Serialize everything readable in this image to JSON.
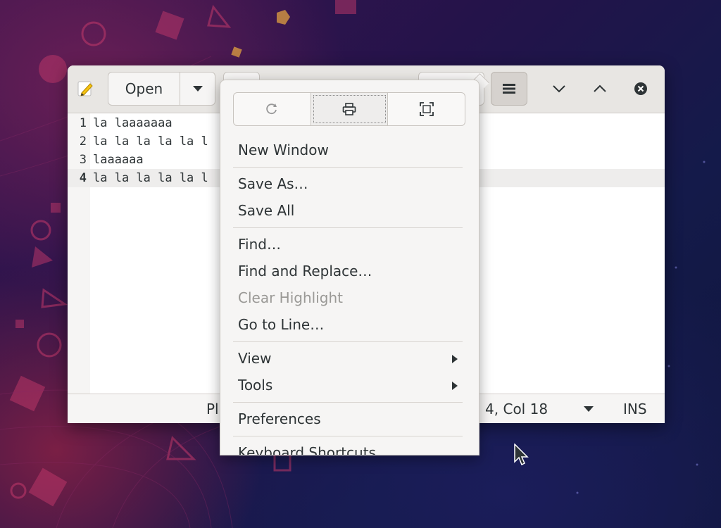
{
  "toolbar": {
    "open_label": "Open",
    "menu_icon": "hamburger-icon",
    "app_icon": "text-editor-icon"
  },
  "editor": {
    "lines": [
      {
        "number": "1",
        "text": "la laaaaaaa"
      },
      {
        "number": "2",
        "text": "la la la la la l"
      },
      {
        "number": "3",
        "text": "laaaaaa"
      },
      {
        "number": "4",
        "text": "la la la la la l"
      }
    ],
    "current_line": 4
  },
  "statusbar": {
    "language_partial": "Pl",
    "position_partial": "n 4, Col 18",
    "mode": "INS"
  },
  "menu": {
    "icons": [
      "reload-icon",
      "print-icon",
      "fullscreen-icon"
    ],
    "new_window": "New Window",
    "save_as": "Save As…",
    "save_all": "Save All",
    "find": "Find…",
    "find_replace": "Find and Replace…",
    "clear_highlight": "Clear Highlight",
    "go_to_line": "Go to Line…",
    "view": "View",
    "tools": "Tools",
    "preferences": "Preferences",
    "keyboard_shortcuts": "Keyboard Shortcuts"
  },
  "colors": {
    "headerbar": "#e8e6e3",
    "menu_bg": "#f6f5f4",
    "text": "#2e3436",
    "disabled_text": "#9a9996"
  }
}
